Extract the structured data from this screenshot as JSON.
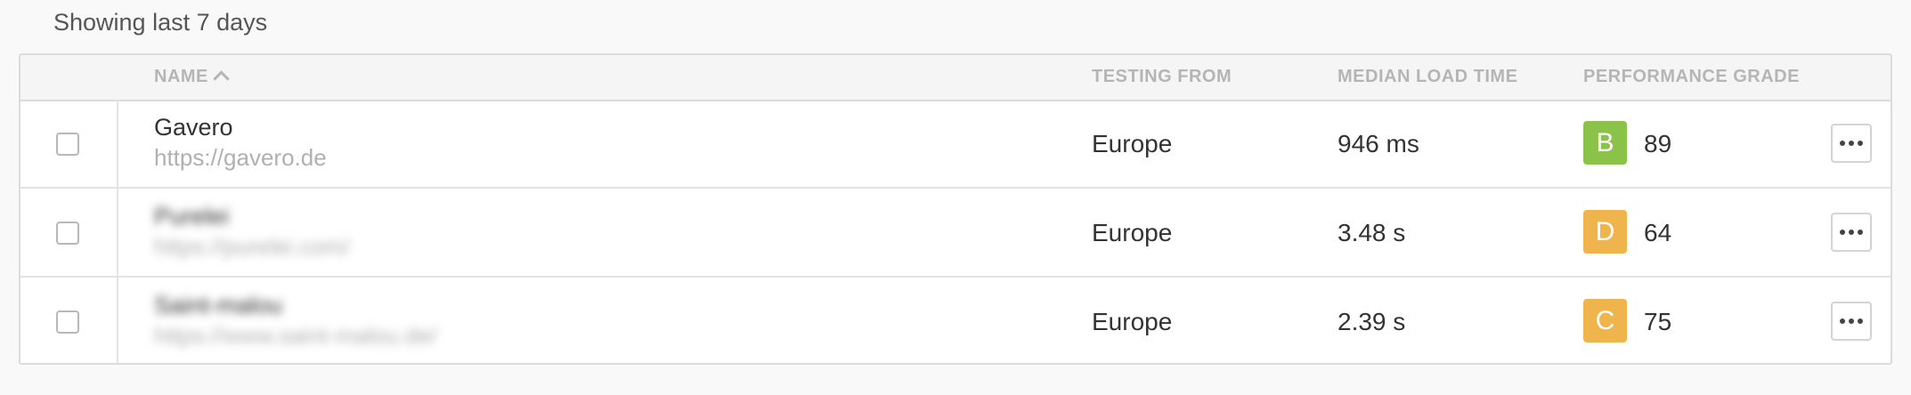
{
  "caption": "Showing last 7 days",
  "columns": {
    "name": "NAME",
    "testing_from": "TESTING FROM",
    "median_load_time": "MEDIAN LOAD TIME",
    "performance_grade": "PERFORMANCE GRADE"
  },
  "rows": [
    {
      "name": "Gavero",
      "url": "https://gavero.de",
      "location": "Europe",
      "load_time": "946 ms",
      "grade": "B",
      "grade_color": "#8bc34a",
      "score": "89"
    },
    {
      "name": "Purelei",
      "url": "https://purelei.com/",
      "location": "Europe",
      "load_time": "3.48 s",
      "grade": "D",
      "grade_color": "#f0b44c",
      "score": "64"
    },
    {
      "name": "Saint-malou",
      "url": "https://www.saint-malou.de/",
      "location": "Europe",
      "load_time": "2.39 s",
      "grade": "C",
      "grade_color": "#f0b44c",
      "score": "75"
    }
  ]
}
